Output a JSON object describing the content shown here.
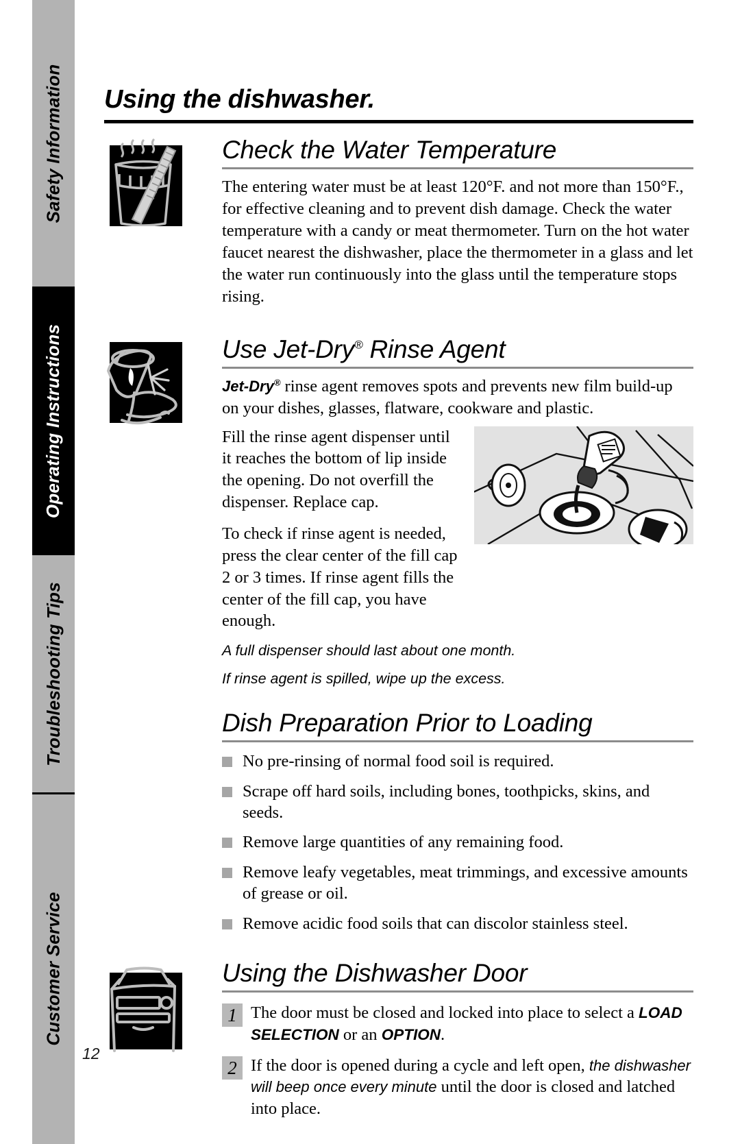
{
  "document": {
    "page_title": "Using the dishwasher.",
    "page_number": "12"
  },
  "sidebar": {
    "tabs": [
      {
        "label": "Safety Information",
        "style": "light"
      },
      {
        "label": "Operating Instructions",
        "style": "dark"
      },
      {
        "label": "Troubleshooting Tips",
        "style": "light"
      },
      {
        "label": "Customer Service",
        "style": "light"
      }
    ]
  },
  "sections": [
    {
      "id": "check-water-temperature",
      "heading": "Check the Water Temperature",
      "icon": "glass-thermometer-icon",
      "paragraphs": [
        "The entering water must be at least 120°F. and not more than 150°F., for effective cleaning and to prevent dish damage. Check the water temperature with a candy or meat thermometer. Turn on the hot water faucet nearest the dishwasher, place the thermometer in a glass and let the water run continuously into the glass until the temperature stops rising."
      ]
    },
    {
      "id": "use-jet-dry-rinse-agent",
      "heading_pre": "Use Jet-Dry",
      "heading_reg": "®",
      "heading_post": " Rinse Agent",
      "icon": "sparkling-glass-icon",
      "intro_brand": "Jet-Dry",
      "intro_brand_reg": "®",
      "intro_rest": " rinse agent removes spots and prevents new film build-up on your dishes, glasses, flatware, cookware and plastic.",
      "paragraphs": [
        "Fill the rinse agent dispenser until it reaches the bottom of lip inside the opening. Do not overfill the dispenser. Replace cap.",
        "To check if rinse agent is needed, press the clear center of the fill cap 2 or 3 times. If rinse agent fills the center of the fill cap, you have enough."
      ],
      "notes": [
        "A full dispenser should last about one month.",
        "If rinse agent is spilled, wipe up the excess."
      ],
      "photo_caption_alt": "rinse-agent-dispenser-photo"
    },
    {
      "id": "dish-preparation-prior-to-loading",
      "heading": "Dish Preparation Prior to Loading",
      "bullets": [
        "No pre-rinsing of normal food soil is required.",
        "Scrape off hard soils, including bones, toothpicks, skins, and seeds.",
        "Remove large quantities of any remaining food.",
        "Remove leafy vegetables, meat trimmings, and excessive amounts of grease or oil.",
        "Remove acidic food soils that can discolor stainless steel."
      ]
    },
    {
      "id": "using-the-dishwasher-door",
      "heading": "Using the Dishwasher Door",
      "icon": "dishwasher-door-icon",
      "steps": [
        {
          "number": "1",
          "part1": "The door must be closed and locked into place to select a ",
          "caps1": "LOAD SELECTION",
          "part2": " or an ",
          "caps2": "OPTION",
          "part3": "."
        },
        {
          "number": "2",
          "part1": "If the door is opened during a cycle and left open, ",
          "ital1": "the dishwasher will beep once every minute",
          "part2": " until the door is closed and latched into place."
        }
      ]
    }
  ],
  "colors": {
    "tab_light": "#b3b3b3",
    "tab_dark": "#000000",
    "rule_dark": "#000000",
    "rule_gray": "#8c8c8c",
    "bullet_square": "#a6a6a6",
    "step_number_box": "#b8b8b8",
    "photo_background": "#e2e2e2"
  }
}
